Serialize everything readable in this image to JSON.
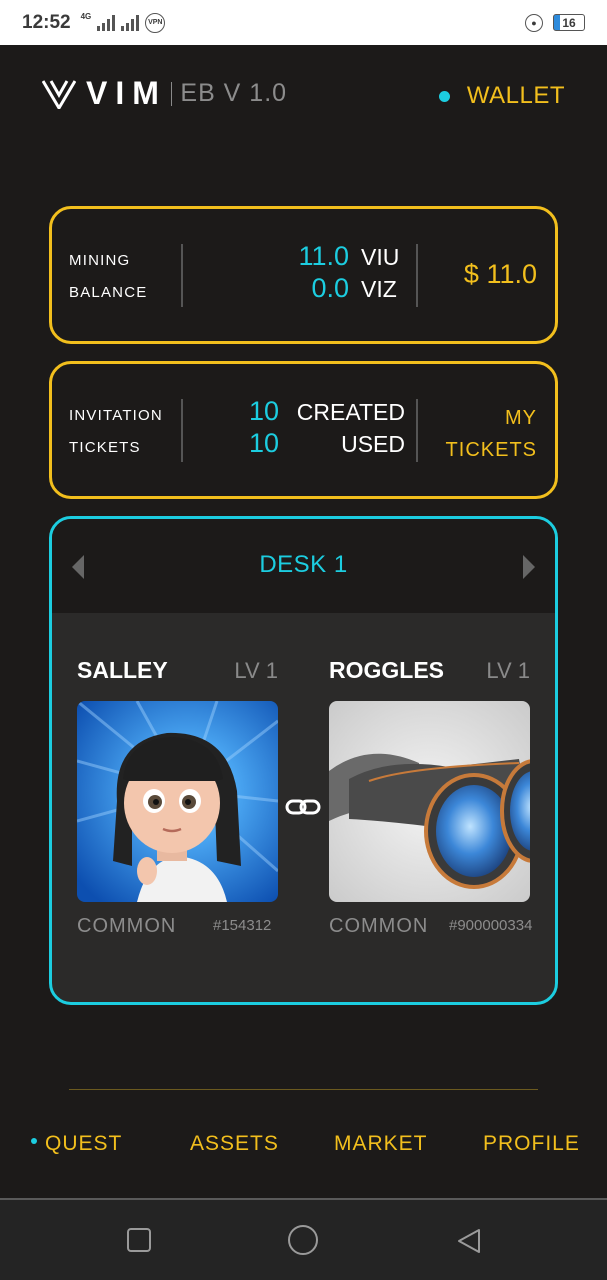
{
  "status_bar": {
    "time": "12:52",
    "network": "4G",
    "vpn": "VPN",
    "battery": "16"
  },
  "header": {
    "logo": "VIM",
    "version": "EB V 1.0",
    "wallet_label": "WALLET"
  },
  "mining_card": {
    "label_line1": "MINING",
    "label_line2": "BALANCE",
    "viu_value": "11.0",
    "viu_unit": "VIU",
    "viz_value": "0.0",
    "viz_unit": "VIZ",
    "usd_value": "$ 11.0"
  },
  "tickets_card": {
    "label_line1": "INVITATION",
    "label_line2": "TICKETS",
    "created_value": "10",
    "created_label": "CREATED",
    "used_value": "10",
    "used_label": "USED",
    "my_tickets_line1": "MY",
    "my_tickets_line2": "TICKETS"
  },
  "desk": {
    "title": "DESK 1",
    "characters": [
      {
        "name": "SALLEY",
        "level": "LV 1",
        "rarity": "COMMON",
        "id": "#154312"
      },
      {
        "name": "ROGGLES",
        "level": "LV 1",
        "rarity": "COMMON",
        "id": "#900000334"
      }
    ]
  },
  "nav": {
    "items": [
      "QUEST",
      "ASSETS",
      "MARKET",
      "PROFILE"
    ],
    "active": "QUEST"
  },
  "colors": {
    "accent_gold": "#f2bf1d",
    "accent_cyan": "#1ccde0",
    "background": "#1c1a19"
  }
}
